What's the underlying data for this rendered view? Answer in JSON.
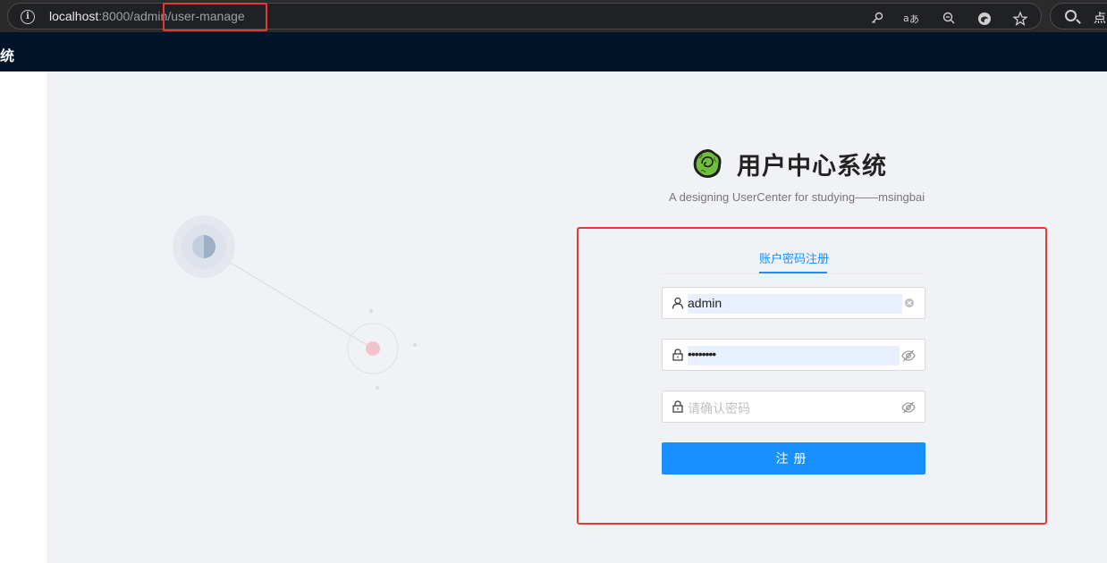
{
  "browser": {
    "url_host": "localhost",
    "url_rest": ":8000/admin/user-manage",
    "search_label": "点"
  },
  "header": {
    "title_fragment": "统"
  },
  "brand": {
    "title": "用户中心系统",
    "subtitle": "A designing UserCenter for studying——msingbai"
  },
  "tabs": [
    {
      "label": "账户密码注册",
      "active": true
    }
  ],
  "form": {
    "username": {
      "value": "admin",
      "placeholder": ""
    },
    "password": {
      "value": "••••••••",
      "placeholder": ""
    },
    "confirm_password": {
      "value": "",
      "placeholder": "请确认密码"
    },
    "submit_label": "注册"
  },
  "colors": {
    "primary": "#1890ff",
    "header_bg": "#001529",
    "annotation": "#e53935"
  }
}
